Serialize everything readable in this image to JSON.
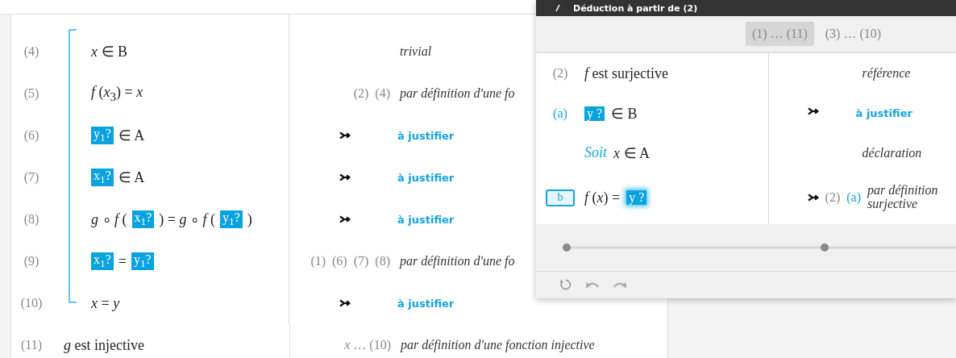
{
  "proof": {
    "rows": [
      {
        "kind": "block",
        "children": [
          {
            "number": "(4)",
            "formula": [
              {
                "kind": "math",
                "text": "*x* ∈ B"
              }
            ],
            "justification": {
              "kind": "text",
              "text": "trivial"
            }
          },
          {
            "number": "(5)",
            "formula": [
              {
                "kind": "math",
                "text": "*f* (*x*$_{3}$) = *x*"
              }
            ],
            "refs": [
              "(2)",
              "(4)"
            ],
            "justification": {
              "kind": "text",
              "text": "par définition d'une fo"
            }
          },
          {
            "number": "(6)",
            "formula": [
              {
                "kind": "hole",
                "text": "y$_{1}$?"
              },
              {
                "kind": "math",
                "text": "∈ A"
              }
            ],
            "justification": {
              "kind": "pending",
              "text": "à justifier"
            }
          },
          {
            "number": "(7)",
            "formula": [
              {
                "kind": "hole",
                "text": "x$_{1}$?"
              },
              {
                "kind": "math",
                "text": "∈ A"
              }
            ],
            "justification": {
              "kind": "pending",
              "text": "à justifier"
            }
          },
          {
            "number": "(8)",
            "formula": [
              {
                "kind": "math",
                "text": "*g* ∘ *f* ("
              },
              {
                "kind": "hole",
                "text": "x$_{1}$?"
              },
              {
                "kind": "math",
                "text": ") = *g* ∘ *f* ("
              },
              {
                "kind": "hole",
                "text": "y$_{1}$?"
              },
              {
                "kind": "math",
                "text": ")"
              }
            ],
            "justification": {
              "kind": "pending",
              "text": "à justifier"
            }
          },
          {
            "number": "(9)",
            "formula": [
              {
                "kind": "hole",
                "text": "x$_{1}$?"
              },
              {
                "kind": "math",
                "text": "="
              },
              {
                "kind": "hole",
                "text": "y$_{1}$?"
              }
            ],
            "refs": [
              "(1)",
              "(6)",
              "(7)",
              "(8)"
            ],
            "justification": {
              "kind": "text",
              "text": "par définition d'une fo"
            }
          },
          {
            "number": "(10)",
            "formula": [
              {
                "kind": "math",
                "text": "*x* = *y*"
              }
            ],
            "justification": {
              "kind": "pending",
              "text": "à justifier"
            }
          }
        ]
      },
      {
        "kind": "line",
        "number": "(11)",
        "formula": [
          {
            "kind": "math",
            "text": "*g* est injective"
          }
        ],
        "refs": [
          "*x* … (10)"
        ],
        "justification": {
          "kind": "text",
          "text": "par définition d'une fonction injective"
        }
      }
    ]
  },
  "dialog": {
    "title": "Déduction à partir de (2)",
    "tabs": [
      {
        "label": "(1) … (11)",
        "selected": true
      },
      {
        "label": "(3) … (10)",
        "selected": false
      }
    ],
    "rows": [
      {
        "label": {
          "kind": "ref",
          "text": "(2)"
        },
        "formula": [
          {
            "kind": "math",
            "text": "*f* est surjective"
          }
        ],
        "justification": {
          "kind": "text",
          "text": "référence"
        }
      },
      {
        "label": {
          "kind": "goal",
          "text": "(a)"
        },
        "formula": [
          {
            "kind": "hole",
            "text": "y ?",
            "focused": false
          },
          {
            "kind": "math",
            "text": "∈ B"
          }
        ],
        "justification": {
          "kind": "pending",
          "text": "à justifier"
        }
      },
      {
        "label": {
          "kind": "none"
        },
        "formula": [
          {
            "kind": "keyword",
            "text": "Soit"
          },
          {
            "kind": "math",
            "text": "*x* ∈ A"
          }
        ],
        "justification": {
          "kind": "text",
          "text": "déclaration"
        }
      },
      {
        "label": {
          "kind": "button",
          "text": "b"
        },
        "formula": [
          {
            "kind": "math",
            "text": "*f* (*x*) ="
          },
          {
            "kind": "hole",
            "text": "y ?",
            "focused": true
          }
        ],
        "refs": [
          {
            "kind": "line",
            "text": "(2)"
          },
          {
            "kind": "goal",
            "text": "(a)"
          }
        ],
        "justification": {
          "kind": "derived",
          "text": "par définition surjective"
        }
      }
    ]
  }
}
